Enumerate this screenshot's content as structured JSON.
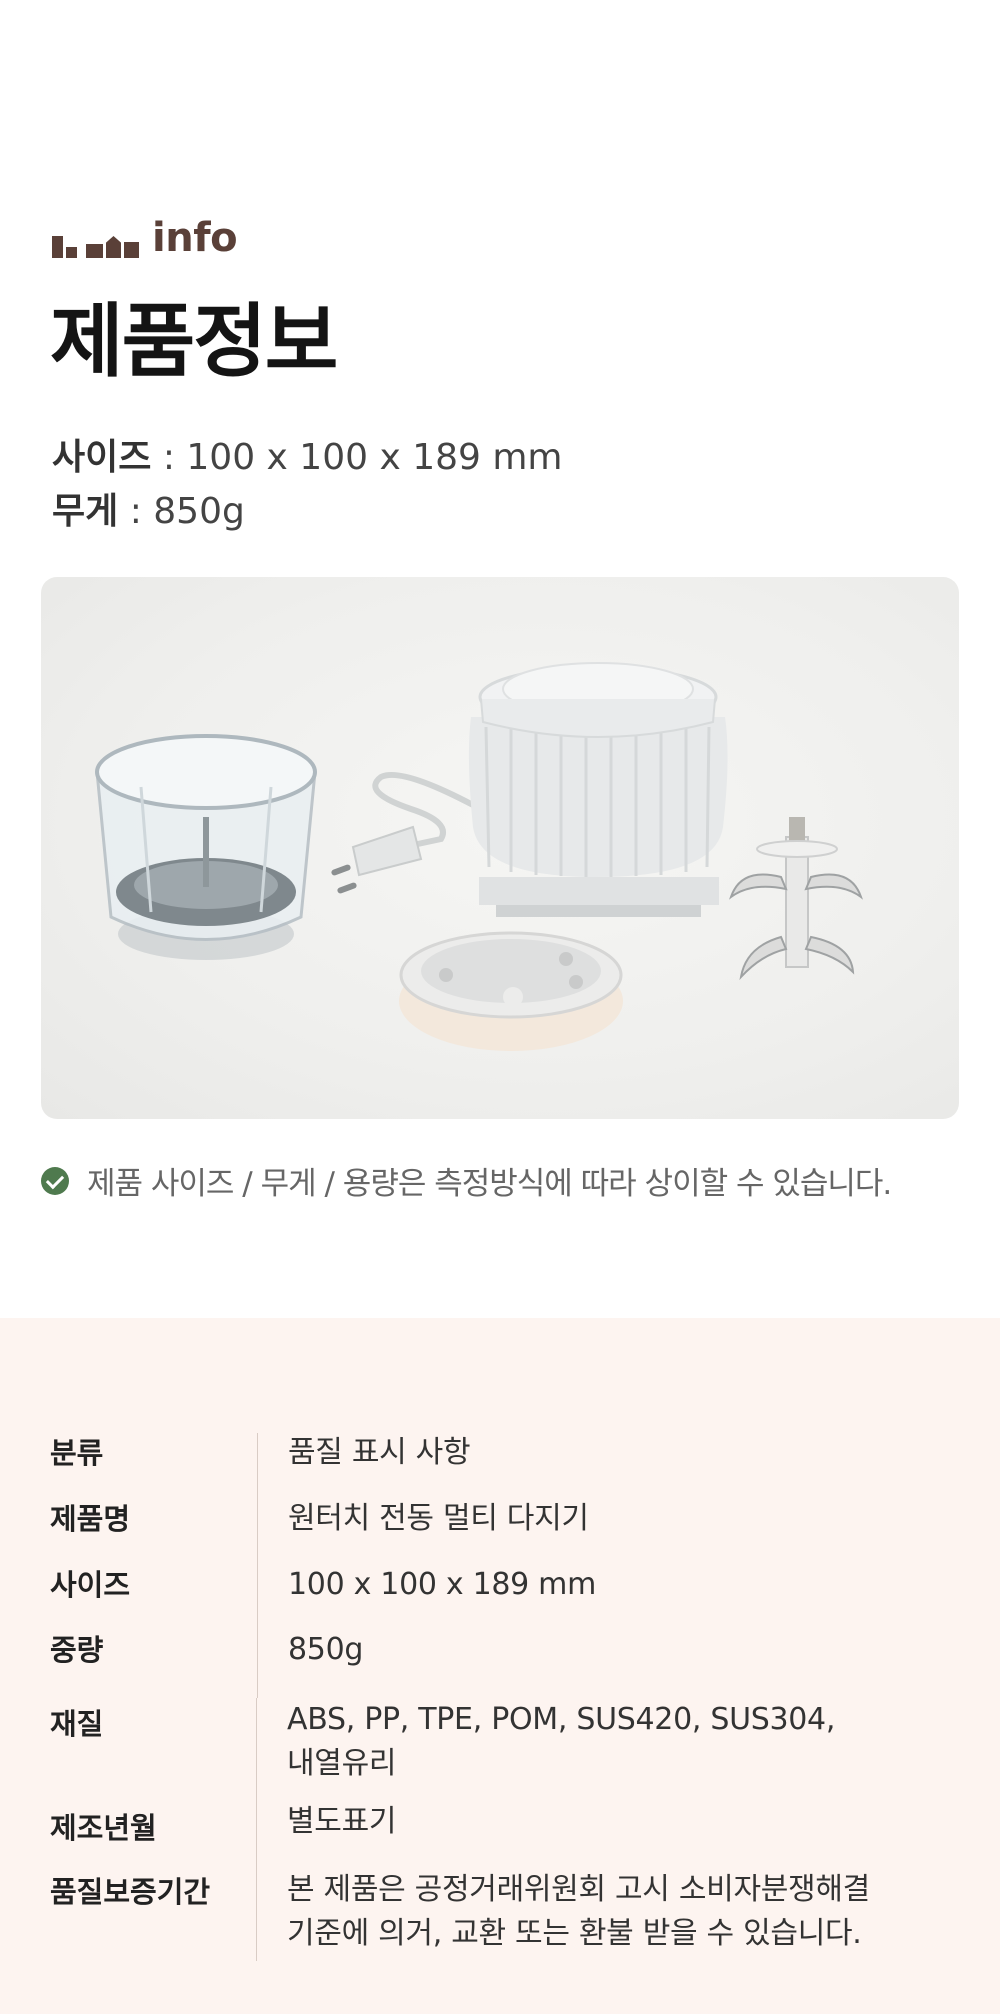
{
  "brand": {
    "logo_text": "info",
    "color": "#5a4038"
  },
  "page_title": "제품정보",
  "specs": {
    "size_label": "사이즈",
    "size_value": " : 100 x 100 x 189 mm",
    "weight_label": "무게",
    "weight_value": " : 850g"
  },
  "photo": {
    "icon": "product-photo"
  },
  "notice": {
    "icon": "check-circle-icon",
    "text": "제품 사이즈 / 무게 / 용량은 측정방식에 따라 상이할 수 있습니다."
  },
  "colors": {
    "accent": "#5a4038",
    "check_green": "#4f7a4e",
    "table_bg": "#fdf4f0"
  },
  "table": {
    "rows": [
      {
        "label": "분류",
        "value": "품질 표시 사항"
      },
      {
        "label": "제품명",
        "value": "원터치 전동 멀티 다지기"
      },
      {
        "label": "사이즈",
        "value": "100 x 100 x 189 mm"
      },
      {
        "label": "중량",
        "value": "850g"
      },
      {
        "label": "재질",
        "value": "ABS, PP, TPE, POM, SUS420, SUS304,\n내열유리"
      },
      {
        "label": "제조년월",
        "value": "별도표기"
      },
      {
        "label": "품질보증기간",
        "value": "본 제품은 공정거래위원회 고시 소비자분쟁해결\n기준에 의거, 교환 또는 환불 받을 수 있습니다."
      }
    ]
  }
}
